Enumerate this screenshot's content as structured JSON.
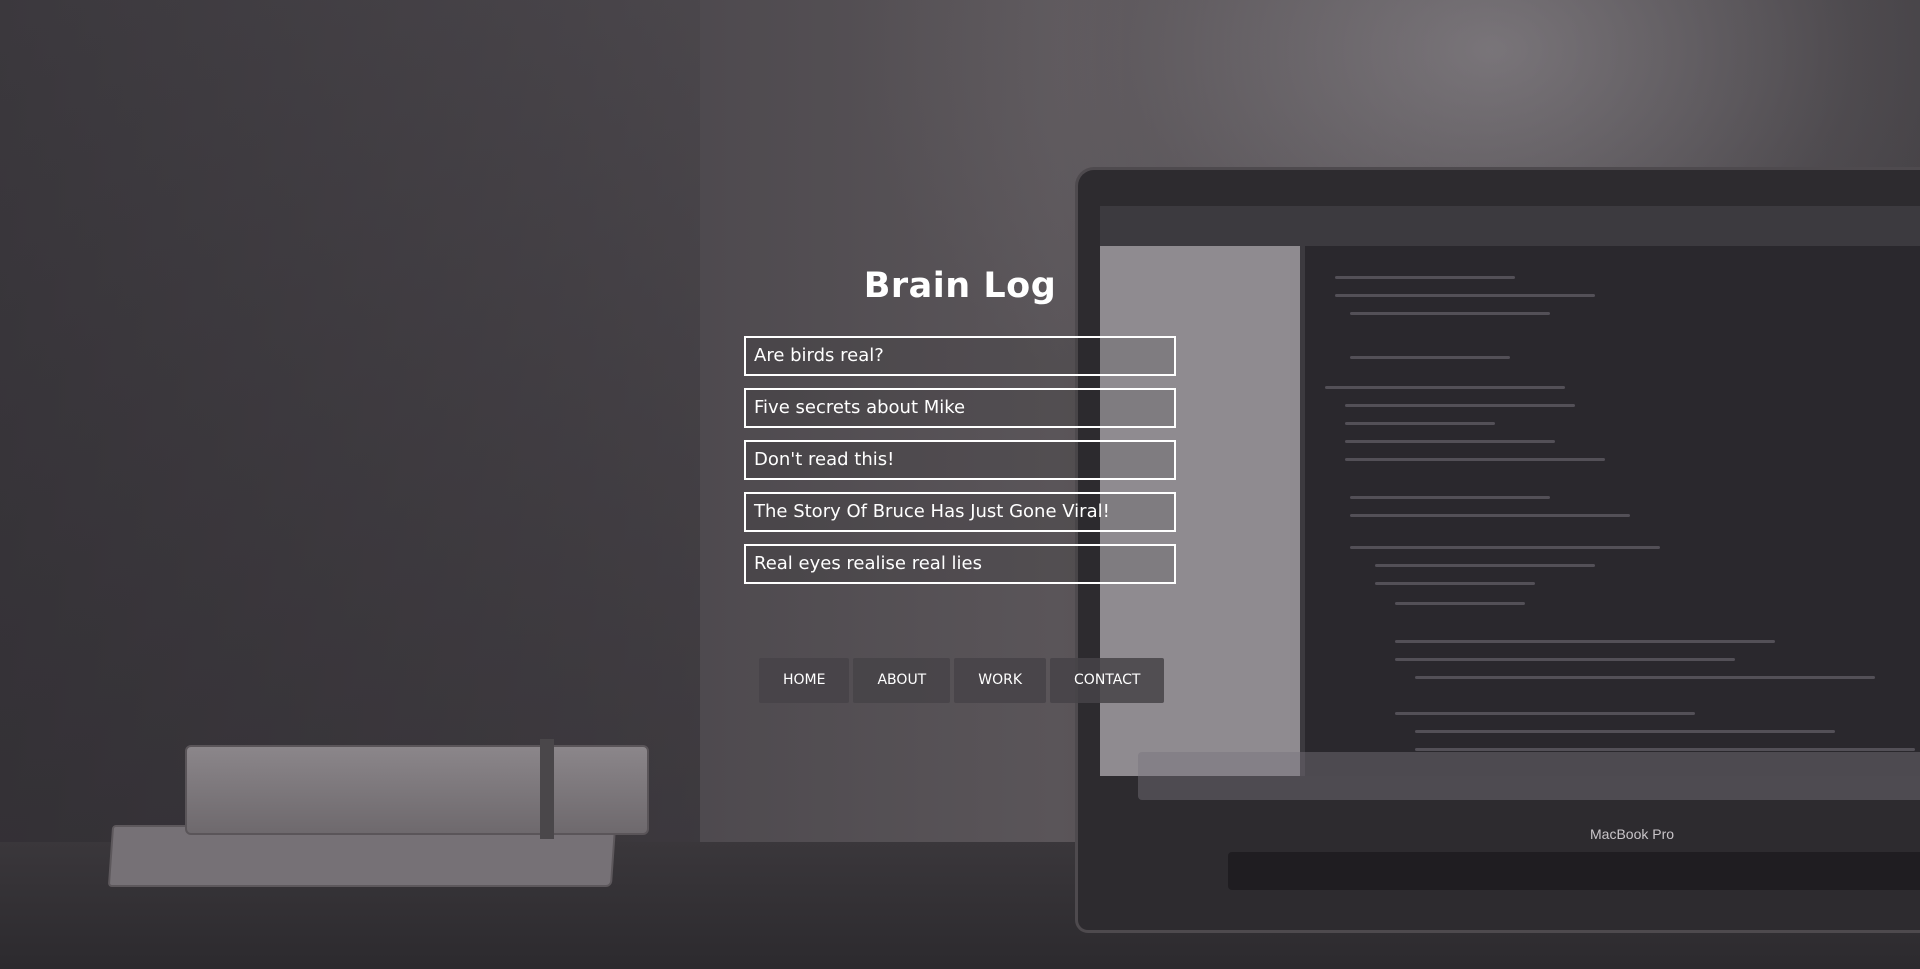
{
  "site": {
    "title": "Brain Log"
  },
  "posts": [
    {
      "title": "Are birds real?"
    },
    {
      "title": "Five secrets about Mike"
    },
    {
      "title": "Don't read this!"
    },
    {
      "title": "The Story Of Bruce Has Just Gone Viral!"
    },
    {
      "title": "Real eyes realise real lies"
    }
  ],
  "nav": {
    "items": [
      {
        "label": "HOME"
      },
      {
        "label": "ABOUT"
      },
      {
        "label": "WORK"
      },
      {
        "label": "CONTACT"
      }
    ]
  },
  "background": {
    "laptop_brand": "MacBook Pro"
  },
  "colors": {
    "text": "#ffffff",
    "border": "#ffffff",
    "nav_bg": "#464348"
  }
}
